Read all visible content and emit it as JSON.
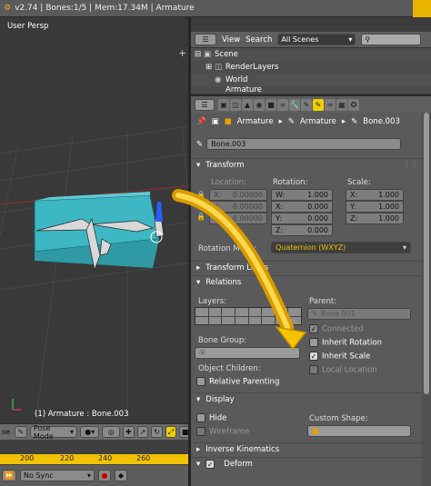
{
  "window": {
    "info": "v2.74 | Bones:1/5  | Mem:17.34M | Armature"
  },
  "viewport": {
    "label": "User Persp",
    "status": "(1) Armature : Bone.003",
    "mode": "Pose Mode",
    "left_cut": "se"
  },
  "timeline": {
    "ticks": [
      "200",
      "220",
      "240",
      "260"
    ],
    "sync": "No Sync"
  },
  "outliner": {
    "view_label": "View",
    "search_label": "Search",
    "filter": "All Scenes",
    "items": [
      "Scene",
      "RenderLayers",
      "World",
      "Armature"
    ]
  },
  "breadcrumb": {
    "items": [
      "Armature",
      "Armature",
      "Bone.003"
    ]
  },
  "bone": {
    "name": "Bone.003"
  },
  "transform": {
    "title": "Transform",
    "location_label": "Location:",
    "rotation_label": "Rotation:",
    "scale_label": "Scale:",
    "location": [
      {
        "axis": "X:",
        "value": "0.00000"
      },
      {
        "axis": "Y:",
        "value": "0.00000"
      },
      {
        "axis": "Z:",
        "value": "0.00000"
      }
    ],
    "rotation": [
      {
        "axis": "W:",
        "value": "1.000"
      },
      {
        "axis": "X:",
        "value": "0.000"
      },
      {
        "axis": "Y:",
        "value": "0.000"
      },
      {
        "axis": "Z:",
        "value": "0.000"
      }
    ],
    "scale": [
      {
        "axis": "X:",
        "value": "1.000"
      },
      {
        "axis": "Y:",
        "value": "1.000"
      },
      {
        "axis": "Z:",
        "value": "1.000"
      }
    ],
    "rotation_mode_label": "Rotation Mode:",
    "rotation_mode": "Quaternion (WXYZ)"
  },
  "transform_locks": {
    "title": "Transform Locks"
  },
  "relations": {
    "title": "Relations",
    "layers_label": "Layers:",
    "parent_label": "Parent:",
    "parent_value": "Bone.001",
    "connected": "Connected",
    "inherit_rotation": "Inherit Rotation",
    "inherit_scale": "Inherit Scale",
    "local_location": "Local Location",
    "bone_group_label": "Bone Group:",
    "object_children_label": "Object Children:",
    "relative_parenting": "Relative Parenting"
  },
  "display": {
    "title": "Display",
    "hide": "Hide",
    "wireframe": "Wireframe",
    "custom_shape_label": "Custom Shape:"
  },
  "inverse_kinematics": {
    "title": "Inverse Kinematics"
  },
  "deform": {
    "title": "Deform"
  },
  "colors": {
    "accent": "#f2c200",
    "mesh": "#39b8c4",
    "selected_tab": "#f0d000"
  }
}
